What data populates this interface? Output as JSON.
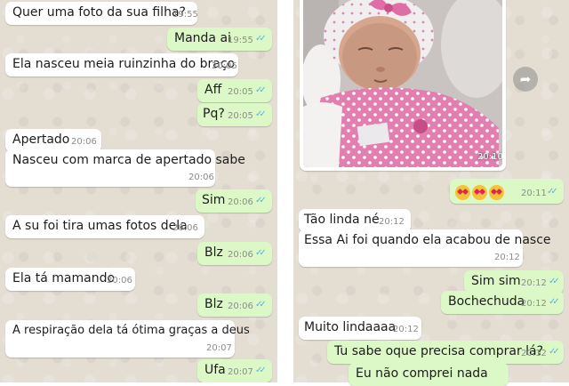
{
  "left_chat": [
    {
      "text": "Quer uma foto da sua filha?",
      "time": "19:55",
      "dir": "in"
    },
    {
      "text": "Manda ai",
      "time": "19:55",
      "dir": "out"
    },
    {
      "text": "Ela nasceu meia ruinzinha do braço",
      "time": "20:05",
      "dir": "in"
    },
    {
      "text": "Aff",
      "time": "20:05",
      "dir": "out"
    },
    {
      "text": "Pq?",
      "time": "20:05",
      "dir": "out"
    },
    {
      "text": "Apertado",
      "time": "20:06",
      "dir": "in"
    },
    {
      "text": "Nasceu com marca de apertado sabe",
      "time": "20:06",
      "dir": "in"
    },
    {
      "text": "Sim",
      "time": "20:06",
      "dir": "out"
    },
    {
      "text": "A su foi tira umas fotos dela",
      "time": "20:06",
      "dir": "in"
    },
    {
      "text": "Blz",
      "time": "20:06",
      "dir": "out"
    },
    {
      "text": "Ela tá mamando",
      "time": "20:06",
      "dir": "in"
    },
    {
      "text": "Blz",
      "time": "20:06",
      "dir": "out"
    },
    {
      "text": "A respiração dela tá ótima graças a deus",
      "time": "20:07",
      "dir": "in"
    },
    {
      "text": "Ufa",
      "time": "20:07",
      "dir": "out"
    }
  ],
  "right_chat": {
    "photo_time": "20:10",
    "emoji_time": "20:11",
    "emoji_icons": [
      "heart-eyes-emoji",
      "heart-eyes-emoji",
      "heart-eyes-emoji"
    ],
    "messages": [
      {
        "text": "Tão linda né",
        "time": "20:12",
        "dir": "in"
      },
      {
        "text": "Essa Ai foi quando ela acabou de nasce",
        "time": "20:12",
        "dir": "in"
      },
      {
        "text": "Sim sim",
        "time": "20:12",
        "dir": "out"
      },
      {
        "text": "Bochechuda",
        "time": "20:12",
        "dir": "out"
      },
      {
        "text": "Muito lindaaaa",
        "time": "20:12",
        "dir": "in"
      },
      {
        "text": "Tu sabe oque precisa comprar lá?",
        "time": "20:12",
        "dir": "out"
      },
      {
        "text": "Eu não comprei nada",
        "time": "",
        "dir": "out"
      }
    ]
  },
  "icons": {
    "forward": "forward-share-icon",
    "read_receipt": "double-check-icon"
  },
  "colors": {
    "incoming_bubble": "#ffffff",
    "outgoing_bubble": "#dcf8c6",
    "read_ticks": "#4fb6ec",
    "wallpaper": "#e3ddd2"
  }
}
